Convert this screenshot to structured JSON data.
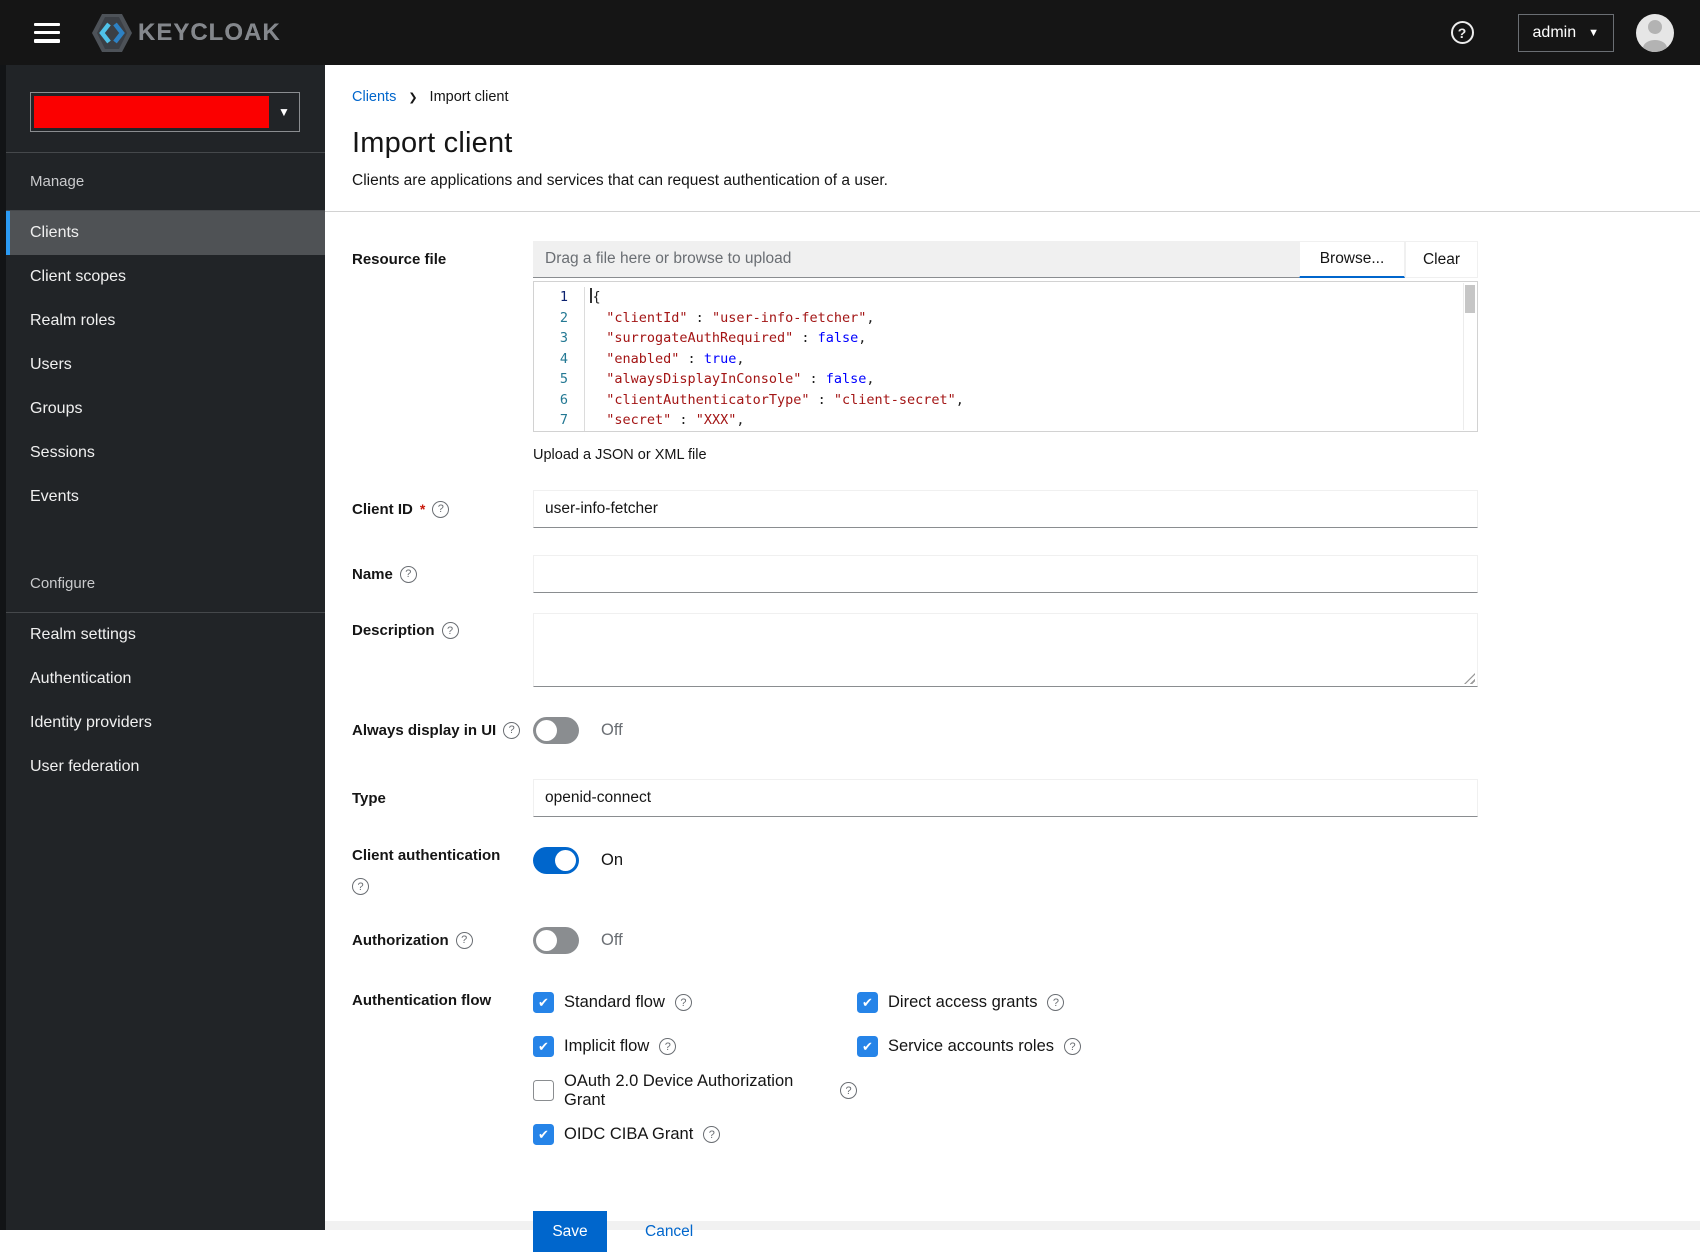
{
  "masthead": {
    "brand": "KEYCLOAK",
    "help_icon": "?",
    "user_menu": "admin"
  },
  "sidebar": {
    "sections": [
      {
        "title": "Manage",
        "items": [
          {
            "label": "Clients",
            "active": true
          },
          {
            "label": "Client scopes",
            "active": false
          },
          {
            "label": "Realm roles",
            "active": false
          },
          {
            "label": "Users",
            "active": false
          },
          {
            "label": "Groups",
            "active": false
          },
          {
            "label": "Sessions",
            "active": false
          },
          {
            "label": "Events",
            "active": false
          }
        ]
      },
      {
        "title": "Configure",
        "items": [
          {
            "label": "Realm settings",
            "active": false
          },
          {
            "label": "Authentication",
            "active": false
          },
          {
            "label": "Identity providers",
            "active": false
          },
          {
            "label": "User federation",
            "active": false
          }
        ]
      }
    ]
  },
  "breadcrumb": {
    "link": "Clients",
    "current": "Import client"
  },
  "page": {
    "title": "Import client",
    "subtitle": "Clients are applications and services that can request authentication of a user."
  },
  "form": {
    "resource_file": {
      "label": "Resource file",
      "placeholder": "Drag a file here or browse to upload",
      "browse": "Browse...",
      "clear": "Clear",
      "help": "Upload a JSON or XML file"
    },
    "editor": {
      "lines": [
        {
          "n": "1",
          "active": true,
          "tokens": [
            {
              "t": "{",
              "c": "p"
            }
          ]
        },
        {
          "n": "2",
          "active": false,
          "tokens": [
            {
              "t": "  ",
              "c": "p"
            },
            {
              "t": "\"clientId\"",
              "c": "k"
            },
            {
              "t": " : ",
              "c": "p"
            },
            {
              "t": "\"user-info-fetcher\"",
              "c": "s"
            },
            {
              "t": ",",
              "c": "p"
            }
          ]
        },
        {
          "n": "3",
          "active": false,
          "tokens": [
            {
              "t": "  ",
              "c": "p"
            },
            {
              "t": "\"surrogateAuthRequired\"",
              "c": "k"
            },
            {
              "t": " : ",
              "c": "p"
            },
            {
              "t": "false",
              "c": "b"
            },
            {
              "t": ",",
              "c": "p"
            }
          ]
        },
        {
          "n": "4",
          "active": false,
          "tokens": [
            {
              "t": "  ",
              "c": "p"
            },
            {
              "t": "\"enabled\"",
              "c": "k"
            },
            {
              "t": " : ",
              "c": "p"
            },
            {
              "t": "true",
              "c": "b"
            },
            {
              "t": ",",
              "c": "p"
            }
          ]
        },
        {
          "n": "5",
          "active": false,
          "tokens": [
            {
              "t": "  ",
              "c": "p"
            },
            {
              "t": "\"alwaysDisplayInConsole\"",
              "c": "k"
            },
            {
              "t": " : ",
              "c": "p"
            },
            {
              "t": "false",
              "c": "b"
            },
            {
              "t": ",",
              "c": "p"
            }
          ]
        },
        {
          "n": "6",
          "active": false,
          "tokens": [
            {
              "t": "  ",
              "c": "p"
            },
            {
              "t": "\"clientAuthenticatorType\"",
              "c": "k"
            },
            {
              "t": " : ",
              "c": "p"
            },
            {
              "t": "\"client-secret\"",
              "c": "s"
            },
            {
              "t": ",",
              "c": "p"
            }
          ]
        },
        {
          "n": "7",
          "active": false,
          "tokens": [
            {
              "t": "  ",
              "c": "p"
            },
            {
              "t": "\"secret\"",
              "c": "k"
            },
            {
              "t": " : ",
              "c": "p"
            },
            {
              "t": "\"XXX\"",
              "c": "s"
            },
            {
              "t": ",",
              "c": "p"
            }
          ]
        }
      ]
    },
    "client_id": {
      "label": "Client ID",
      "required": "*",
      "value": "user-info-fetcher"
    },
    "name": {
      "label": "Name",
      "value": ""
    },
    "description": {
      "label": "Description",
      "value": ""
    },
    "always_display": {
      "label": "Always display in UI",
      "state": "Off"
    },
    "type": {
      "label": "Type",
      "value": "openid-connect"
    },
    "client_auth": {
      "label": "Client authentication",
      "state": "On"
    },
    "authorization": {
      "label": "Authorization",
      "state": "Off"
    },
    "auth_flow": {
      "label": "Authentication flow",
      "items": [
        {
          "label": "Standard flow",
          "checked": true,
          "col": 1
        },
        {
          "label": "Direct access grants",
          "checked": true,
          "col": 2
        },
        {
          "label": "Implicit flow",
          "checked": true,
          "col": 1
        },
        {
          "label": "Service accounts roles",
          "checked": true,
          "col": 2
        },
        {
          "label": "OAuth 2.0 Device Authorization Grant",
          "checked": false,
          "col": 1
        },
        {
          "label": "OIDC CIBA Grant",
          "checked": true,
          "col": 1
        }
      ]
    },
    "actions": {
      "save": "Save",
      "cancel": "Cancel"
    }
  },
  "colors": {
    "primary": "#0066cc",
    "checkbox_blue": "#2684e8",
    "nav_active": "#2b9af3",
    "masthead_bg": "#151515",
    "sidebar_bg": "#212427",
    "sidebar_active_bg": "#4f5255",
    "redaction": "#fb0000",
    "code_string": "#a31515",
    "code_bool": "#0000ff",
    "line_number": "#237893"
  }
}
